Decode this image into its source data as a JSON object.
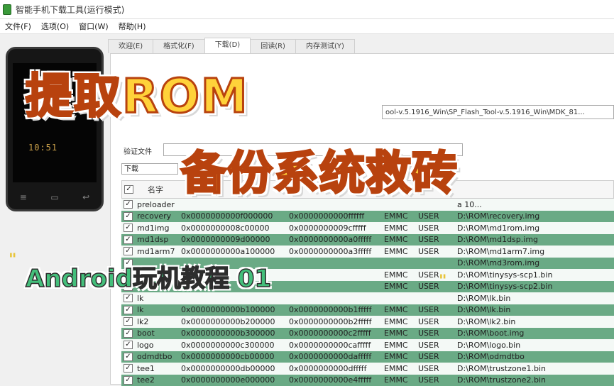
{
  "window": {
    "title": "智能手机下载工具(运行模式)"
  },
  "menu": [
    "文件(F)",
    "选项(O)",
    "窗口(W)",
    "帮助(H)"
  ],
  "tabs": [
    "欢迎(E)",
    "格式化(F)",
    "下载(D)",
    "回读(R)",
    "内存测试(Y)"
  ],
  "path_text": "ool-v.5.1916_Win\\SP_Flash_Tool-v.5.1916_Win\\MDK_81...",
  "scatter_label": "验证文件",
  "download_mode": "下载",
  "table": {
    "header_name": "名字",
    "rows": [
      {
        "name": "preloader",
        "begin": "",
        "end": "",
        "type": "",
        "region": "",
        "location": "a 10...",
        "checked": true
      },
      {
        "name": "recovery",
        "begin": "0x0000000000f000000",
        "end": "0x0000000000ffffff",
        "type": "EMMC",
        "region": "USER",
        "location": "D:\\ROM\\recovery.img",
        "checked": true
      },
      {
        "name": "md1img",
        "begin": "0x0000000008c00000",
        "end": "0x0000000009cfffff",
        "type": "EMMC",
        "region": "USER",
        "location": "D:\\ROM\\md1rom.img",
        "checked": true
      },
      {
        "name": "md1dsp",
        "begin": "0x0000000009d00000",
        "end": "0x0000000000a0fffff",
        "type": "EMMC",
        "region": "USER",
        "location": "D:\\ROM\\md1dsp.img",
        "checked": true
      },
      {
        "name": "md1arm7",
        "begin": "0x0000000000a100000",
        "end": "0x0000000000a3fffff",
        "type": "EMMC",
        "region": "USER",
        "location": "D:\\ROM\\md1arm7.img",
        "checked": true
      },
      {
        "name": "",
        "begin": "",
        "end": "",
        "type": "",
        "region": "",
        "location": "D:\\ROM\\md3rom.img",
        "checked": true
      },
      {
        "name": "",
        "begin": "",
        "end": "",
        "type": "EMMC",
        "region": "USER",
        "location": "D:\\ROM\\tinysys-scp1.bin",
        "checked": true
      },
      {
        "name": "",
        "begin": "",
        "end": "",
        "type": "EMMC",
        "region": "USER",
        "location": "D:\\ROM\\tinysys-scp2.bin",
        "checked": true
      },
      {
        "name": "lk",
        "begin": "",
        "end": "",
        "type": "",
        "region": "",
        "location": "D:\\ROM\\lk.bin",
        "checked": true
      },
      {
        "name": "lk",
        "begin": "0x0000000000b100000",
        "end": "0x0000000000b1fffff",
        "type": "EMMC",
        "region": "USER",
        "location": "D:\\ROM\\lk.bin",
        "checked": true
      },
      {
        "name": "lk2",
        "begin": "0x0000000000b200000",
        "end": "0x0000000000b2fffff",
        "type": "EMMC",
        "region": "USER",
        "location": "D:\\ROM\\lk2.bin",
        "checked": true
      },
      {
        "name": "boot",
        "begin": "0x0000000000b300000",
        "end": "0x0000000000c2fffff",
        "type": "EMMC",
        "region": "USER",
        "location": "D:\\ROM\\boot.img",
        "checked": true
      },
      {
        "name": "logo",
        "begin": "0x0000000000c300000",
        "end": "0x0000000000cafffff",
        "type": "EMMC",
        "region": "USER",
        "location": "D:\\ROM\\logo.bin",
        "checked": true
      },
      {
        "name": "odmdtbo",
        "begin": "0x0000000000cb00000",
        "end": "0x0000000000dafffff",
        "type": "EMMC",
        "region": "USER",
        "location": "D:\\ROM\\odmdtbo",
        "checked": true
      },
      {
        "name": "tee1",
        "begin": "0x0000000000db00000",
        "end": "0x0000000000dfffff",
        "type": "EMMC",
        "region": "USER",
        "location": "D:\\ROM\\trustzone1.bin",
        "checked": true
      },
      {
        "name": "tee2",
        "begin": "0x0000000000e000000",
        "end": "0x0000000000e4fffff",
        "type": "EMMC",
        "region": "USER",
        "location": "D:\\ROM\\trustzone2.bin",
        "checked": true
      }
    ]
  },
  "overlay": {
    "line1": "提取ROM",
    "line2": "备份系统救砖",
    "line3": "Android玩机教程 01"
  },
  "phone": {
    "time": "10:51"
  }
}
